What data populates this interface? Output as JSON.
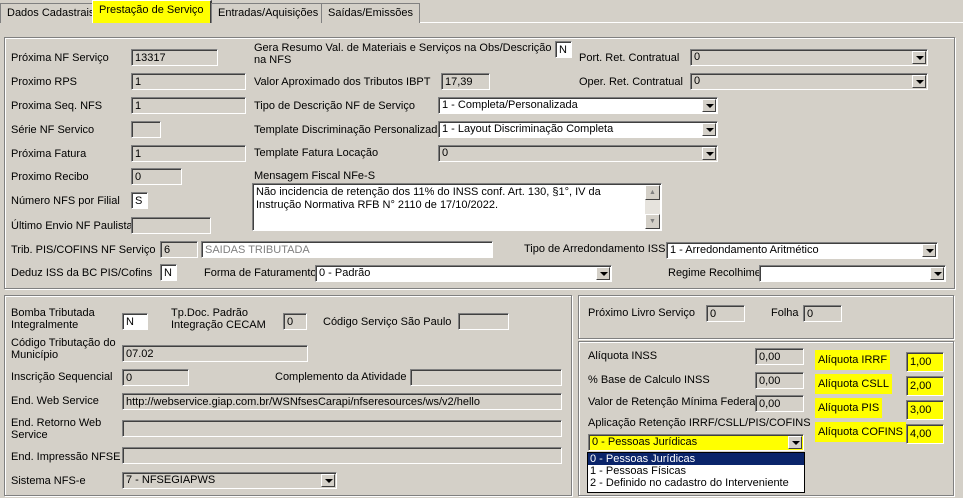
{
  "tabs": [
    "Dados Cadastrais",
    "Prestação de Serviço",
    "Entradas/Aquisições",
    "Saídas/Emissões"
  ],
  "active_tab": "Prestação de Serviço",
  "top": {
    "proxima_nf_servico_label": "Próxima NF Serviço",
    "proxima_nf_servico_value": "13317",
    "proximo_rps_label": "Proximo RPS",
    "proximo_rps_value": "1",
    "proxima_seq_nfs_label": "Proxima Seq. NFS",
    "proxima_seq_nfs_value": "1",
    "serie_nf_label": "Série NF Servico",
    "serie_nf_value": "",
    "proxima_fatura_label": "Próxima Fatura",
    "proxima_fatura_value": "1",
    "proximo_recibo_label": "Proximo Recibo",
    "proximo_recibo_value": "0",
    "numero_nfs_filial_label": "Número NFS por Filial",
    "numero_nfs_filial_value": "S",
    "ultimo_envio_label": "Último Envio NF Paulista",
    "ultimo_envio_value": "",
    "gera_resumo_label": "Gera Resumo Val. de Materiais e Serviços na Obs/Descrição na NFS",
    "gera_resumo_value": "N",
    "valor_aprox_label": "Valor Aproximado dos Tributos IBPT",
    "valor_aprox_value": "17,39",
    "tipo_descricao_label": "Tipo de Descrição NF de Serviço",
    "tipo_descricao_value": "1 - Completa/Personalizada",
    "template_disc_label": "Template Discriminação Personalizada",
    "template_disc_value": "1 - Layout Discriminação Completa",
    "template_fatura_label": "Template Fatura Locação",
    "template_fatura_value": "0",
    "mensagem_fiscal_label": "Mensagem Fiscal NFe-S",
    "mensagem_fiscal_value": "Não incidencia de retenção dos 11% do INSS conf. Art. 130, §1°, IV da Instrução Normativa RFB N° 2110 de 17/10/2022.",
    "port_ret_label": "Port. Ret. Contratual",
    "port_ret_value": "0",
    "oper_ret_label": "Oper. Ret. Contratual",
    "oper_ret_value": "0",
    "trib_pis_label": "Trib. PIS/COFINS NF Serviço",
    "trib_pis_code": "6",
    "trib_pis_desc": "SAIDAS TRIBUTADA",
    "tipo_arred_label": "Tipo de Arredondamento ISS",
    "tipo_arred_value": "1 - Arredondamento Aritmético",
    "deduz_iss_label": "Deduz ISS da BC PIS/Cofins",
    "deduz_iss_value": "N",
    "forma_fat_label": "Forma de Faturamento",
    "forma_fat_value": "0 - Padrão",
    "regime_label": "Regime Recolhimento",
    "regime_value": ""
  },
  "left": {
    "bomba_label": "Bomba Tributada Integralmente",
    "bomba_value": "N",
    "tpdoc_label": "Tp.Doc. Padrão Integração CECAM",
    "tpdoc_value": "0",
    "codigo_sp_label": "Código Serviço São Paulo",
    "codigo_sp_value": "",
    "codigo_trib_label": "Código Tributação do Município",
    "codigo_trib_value": "07.02",
    "inscricao_label": "Inscrição Sequencial",
    "inscricao_value": "0",
    "complemento_label": "Complemento da Atividade",
    "complemento_value": "",
    "end_web_label": "End. Web Service",
    "end_web_value": "http://webservice.giap.com.br/WSNfsesCarapi/nfseresources/ws/v2/hello",
    "end_retorno_label": "End. Retorno Web Service",
    "end_retorno_value": "",
    "end_impressao_label": "End. Impressão NFSE",
    "end_impressao_value": "",
    "sistema_label": "Sistema NFS-e",
    "sistema_value": "7 - NFSEGIAPWS"
  },
  "right_top": {
    "livro_label": "Próximo Livro Serviço",
    "livro_value": "0",
    "folha_label": "Folha",
    "folha_value": "0"
  },
  "right_bottom": {
    "aliq_inss_label": "Alíquota INSS",
    "aliq_inss_value": "0,00",
    "base_inss_label": "% Base de Calculo INSS",
    "base_inss_value": "0,00",
    "valor_min_label": "Valor de Retenção Mínima Federal",
    "valor_min_value": "0,00",
    "aplicacao_label": "Aplicação Retenção IRRF/CSLL/PIS/COFINS",
    "aplicacao_value": "0 - Pessoas Jurídicas",
    "aplicacao_options": [
      "0 - Pessoas Jurídicas",
      "1 - Pessoas Físicas",
      "2 - Definido no cadastro do Interveniente"
    ],
    "aliq_irrf_label": "Alíquota IRRF",
    "aliq_irrf_value": "1,00",
    "aliq_csll_label": "Alíquota CSLL",
    "aliq_csll_value": "2,00",
    "aliq_pis_label": "Alíquota PIS",
    "aliq_pis_value": "3,00",
    "aliq_cofins_label": "Alíquota COFINS",
    "aliq_cofins_value": "4,00"
  },
  "colors": {
    "highlight": "#ffff00",
    "window": "#d4d0c8",
    "selection": "#0a246a"
  }
}
